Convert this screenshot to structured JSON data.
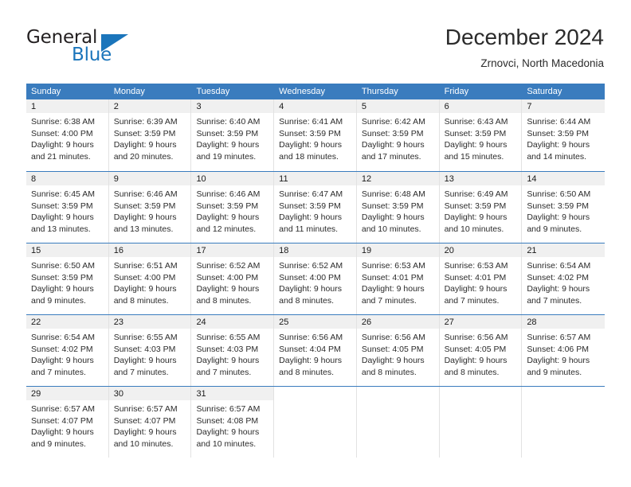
{
  "brand": {
    "name_part1": "General",
    "name_part2": "Blue",
    "logo_icon": "triangle-logo-icon",
    "accent_color": "#1b75bb"
  },
  "header": {
    "title": "December 2024",
    "subtitle": "Zrnovci, North Macedonia"
  },
  "theme": {
    "header_row_bg": "#3a7cbe",
    "day_number_bg": "#f0f0f0",
    "cell_bg": "#ffffff",
    "text_color": "#2b2b2b"
  },
  "calendar": {
    "weekdays": [
      "Sunday",
      "Monday",
      "Tuesday",
      "Wednesday",
      "Thursday",
      "Friday",
      "Saturday"
    ],
    "weeks": [
      [
        {
          "day": "1",
          "sunrise": "Sunrise: 6:38 AM",
          "sunset": "Sunset: 4:00 PM",
          "daylight_line1": "Daylight: 9 hours",
          "daylight_line2": "and 21 minutes."
        },
        {
          "day": "2",
          "sunrise": "Sunrise: 6:39 AM",
          "sunset": "Sunset: 3:59 PM",
          "daylight_line1": "Daylight: 9 hours",
          "daylight_line2": "and 20 minutes."
        },
        {
          "day": "3",
          "sunrise": "Sunrise: 6:40 AM",
          "sunset": "Sunset: 3:59 PM",
          "daylight_line1": "Daylight: 9 hours",
          "daylight_line2": "and 19 minutes."
        },
        {
          "day": "4",
          "sunrise": "Sunrise: 6:41 AM",
          "sunset": "Sunset: 3:59 PM",
          "daylight_line1": "Daylight: 9 hours",
          "daylight_line2": "and 18 minutes."
        },
        {
          "day": "5",
          "sunrise": "Sunrise: 6:42 AM",
          "sunset": "Sunset: 3:59 PM",
          "daylight_line1": "Daylight: 9 hours",
          "daylight_line2": "and 17 minutes."
        },
        {
          "day": "6",
          "sunrise": "Sunrise: 6:43 AM",
          "sunset": "Sunset: 3:59 PM",
          "daylight_line1": "Daylight: 9 hours",
          "daylight_line2": "and 15 minutes."
        },
        {
          "day": "7",
          "sunrise": "Sunrise: 6:44 AM",
          "sunset": "Sunset: 3:59 PM",
          "daylight_line1": "Daylight: 9 hours",
          "daylight_line2": "and 14 minutes."
        }
      ],
      [
        {
          "day": "8",
          "sunrise": "Sunrise: 6:45 AM",
          "sunset": "Sunset: 3:59 PM",
          "daylight_line1": "Daylight: 9 hours",
          "daylight_line2": "and 13 minutes."
        },
        {
          "day": "9",
          "sunrise": "Sunrise: 6:46 AM",
          "sunset": "Sunset: 3:59 PM",
          "daylight_line1": "Daylight: 9 hours",
          "daylight_line2": "and 13 minutes."
        },
        {
          "day": "10",
          "sunrise": "Sunrise: 6:46 AM",
          "sunset": "Sunset: 3:59 PM",
          "daylight_line1": "Daylight: 9 hours",
          "daylight_line2": "and 12 minutes."
        },
        {
          "day": "11",
          "sunrise": "Sunrise: 6:47 AM",
          "sunset": "Sunset: 3:59 PM",
          "daylight_line1": "Daylight: 9 hours",
          "daylight_line2": "and 11 minutes."
        },
        {
          "day": "12",
          "sunrise": "Sunrise: 6:48 AM",
          "sunset": "Sunset: 3:59 PM",
          "daylight_line1": "Daylight: 9 hours",
          "daylight_line2": "and 10 minutes."
        },
        {
          "day": "13",
          "sunrise": "Sunrise: 6:49 AM",
          "sunset": "Sunset: 3:59 PM",
          "daylight_line1": "Daylight: 9 hours",
          "daylight_line2": "and 10 minutes."
        },
        {
          "day": "14",
          "sunrise": "Sunrise: 6:50 AM",
          "sunset": "Sunset: 3:59 PM",
          "daylight_line1": "Daylight: 9 hours",
          "daylight_line2": "and 9 minutes."
        }
      ],
      [
        {
          "day": "15",
          "sunrise": "Sunrise: 6:50 AM",
          "sunset": "Sunset: 3:59 PM",
          "daylight_line1": "Daylight: 9 hours",
          "daylight_line2": "and 9 minutes."
        },
        {
          "day": "16",
          "sunrise": "Sunrise: 6:51 AM",
          "sunset": "Sunset: 4:00 PM",
          "daylight_line1": "Daylight: 9 hours",
          "daylight_line2": "and 8 minutes."
        },
        {
          "day": "17",
          "sunrise": "Sunrise: 6:52 AM",
          "sunset": "Sunset: 4:00 PM",
          "daylight_line1": "Daylight: 9 hours",
          "daylight_line2": "and 8 minutes."
        },
        {
          "day": "18",
          "sunrise": "Sunrise: 6:52 AM",
          "sunset": "Sunset: 4:00 PM",
          "daylight_line1": "Daylight: 9 hours",
          "daylight_line2": "and 8 minutes."
        },
        {
          "day": "19",
          "sunrise": "Sunrise: 6:53 AM",
          "sunset": "Sunset: 4:01 PM",
          "daylight_line1": "Daylight: 9 hours",
          "daylight_line2": "and 7 minutes."
        },
        {
          "day": "20",
          "sunrise": "Sunrise: 6:53 AM",
          "sunset": "Sunset: 4:01 PM",
          "daylight_line1": "Daylight: 9 hours",
          "daylight_line2": "and 7 minutes."
        },
        {
          "day": "21",
          "sunrise": "Sunrise: 6:54 AM",
          "sunset": "Sunset: 4:02 PM",
          "daylight_line1": "Daylight: 9 hours",
          "daylight_line2": "and 7 minutes."
        }
      ],
      [
        {
          "day": "22",
          "sunrise": "Sunrise: 6:54 AM",
          "sunset": "Sunset: 4:02 PM",
          "daylight_line1": "Daylight: 9 hours",
          "daylight_line2": "and 7 minutes."
        },
        {
          "day": "23",
          "sunrise": "Sunrise: 6:55 AM",
          "sunset": "Sunset: 4:03 PM",
          "daylight_line1": "Daylight: 9 hours",
          "daylight_line2": "and 7 minutes."
        },
        {
          "day": "24",
          "sunrise": "Sunrise: 6:55 AM",
          "sunset": "Sunset: 4:03 PM",
          "daylight_line1": "Daylight: 9 hours",
          "daylight_line2": "and 7 minutes."
        },
        {
          "day": "25",
          "sunrise": "Sunrise: 6:56 AM",
          "sunset": "Sunset: 4:04 PM",
          "daylight_line1": "Daylight: 9 hours",
          "daylight_line2": "and 8 minutes."
        },
        {
          "day": "26",
          "sunrise": "Sunrise: 6:56 AM",
          "sunset": "Sunset: 4:05 PM",
          "daylight_line1": "Daylight: 9 hours",
          "daylight_line2": "and 8 minutes."
        },
        {
          "day": "27",
          "sunrise": "Sunrise: 6:56 AM",
          "sunset": "Sunset: 4:05 PM",
          "daylight_line1": "Daylight: 9 hours",
          "daylight_line2": "and 8 minutes."
        },
        {
          "day": "28",
          "sunrise": "Sunrise: 6:57 AM",
          "sunset": "Sunset: 4:06 PM",
          "daylight_line1": "Daylight: 9 hours",
          "daylight_line2": "and 9 minutes."
        }
      ],
      [
        {
          "day": "29",
          "sunrise": "Sunrise: 6:57 AM",
          "sunset": "Sunset: 4:07 PM",
          "daylight_line1": "Daylight: 9 hours",
          "daylight_line2": "and 9 minutes."
        },
        {
          "day": "30",
          "sunrise": "Sunrise: 6:57 AM",
          "sunset": "Sunset: 4:07 PM",
          "daylight_line1": "Daylight: 9 hours",
          "daylight_line2": "and 10 minutes."
        },
        {
          "day": "31",
          "sunrise": "Sunrise: 6:57 AM",
          "sunset": "Sunset: 4:08 PM",
          "daylight_line1": "Daylight: 9 hours",
          "daylight_line2": "and 10 minutes."
        },
        {
          "day": "",
          "sunrise": "",
          "sunset": "",
          "daylight_line1": "",
          "daylight_line2": ""
        },
        {
          "day": "",
          "sunrise": "",
          "sunset": "",
          "daylight_line1": "",
          "daylight_line2": ""
        },
        {
          "day": "",
          "sunrise": "",
          "sunset": "",
          "daylight_line1": "",
          "daylight_line2": ""
        },
        {
          "day": "",
          "sunrise": "",
          "sunset": "",
          "daylight_line1": "",
          "daylight_line2": ""
        }
      ]
    ]
  }
}
